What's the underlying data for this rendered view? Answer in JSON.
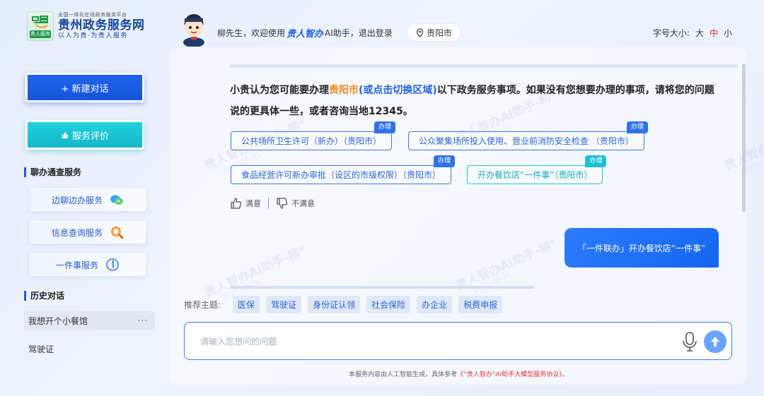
{
  "logo": {
    "subtitle": "全国一体化在线政务服务平台",
    "title": "贵州政务服务网",
    "slogan": "以人为贵·为贵人服务",
    "tag": "贵人服务"
  },
  "header": {
    "welcome_prefix": "柳先生，欢迎使用",
    "brand": "贵人智办",
    "welcome_suffix": "AI助手，",
    "logout": "退出登录",
    "city": "贵阳市",
    "font_size_label": "字号大小:",
    "font_sizes": [
      "大",
      "中",
      "小"
    ],
    "font_size_active": "中"
  },
  "sidebar": {
    "new_chat": "+ 新建对话",
    "service_eval": "服务评价",
    "section_services": "聊办通查服务",
    "services": [
      {
        "label": "边聊边办服务",
        "icon": "chat-bubbles-icon"
      },
      {
        "label": "信息查询服务",
        "icon": "search-magnifier-icon"
      },
      {
        "label": "一件事服务",
        "icon": "one-thing-icon"
      }
    ],
    "section_history": "历史对话",
    "history": [
      {
        "label": "我想开个小餐馆",
        "more": "···"
      },
      {
        "label": "驾驶证"
      }
    ]
  },
  "chat": {
    "answer_p1": "小贵认为您可能要办理",
    "answer_city": "贵阳市",
    "answer_switch": "(或点击切换区域)",
    "answer_p2": "以下政务服务事项。如果没有您想要办理的事项，请将您的问题说的更具体一些，或者咨询当地12345。",
    "items": [
      {
        "label": "公共场所卫生许可（新办）（贵阳市）",
        "badge": "办理"
      },
      {
        "label": "公众聚集场所投入使用、营业前消防安全检查 （贵阳市）",
        "badge": "办理"
      },
      {
        "label": "食品经营许可新办审批（设区的市级权限）（贵阳市）",
        "badge": "办理"
      },
      {
        "label": "开办餐饮店“一件事”（贵阳市）",
        "badge": "办理"
      }
    ],
    "feedback_good": "满意",
    "feedback_bad": "不满意",
    "user_message": "「一件联办」开办餐饮店“一件事”"
  },
  "topics": {
    "label": "推荐主题:",
    "items": [
      "医保",
      "驾驶证",
      "身份证认领",
      "社会保险",
      "办企业",
      "税费申报"
    ]
  },
  "input": {
    "placeholder": "请输入您想问的问题"
  },
  "footer": {
    "note_prefix": "本服务内容由人工智能生成，具体参考",
    "protocol": "《“贵人智办”AI助手大模型服务协议》",
    "note_suffix": "。"
  },
  "watermark": {
    "text": "贵人智办AI助手-柳*",
    "date": "2025-09-01"
  },
  "colors": {
    "primary": "#1d5be0",
    "teal": "#14b8c9",
    "accent_orange": "#f28a1a",
    "active_red": "#e02d2d"
  }
}
